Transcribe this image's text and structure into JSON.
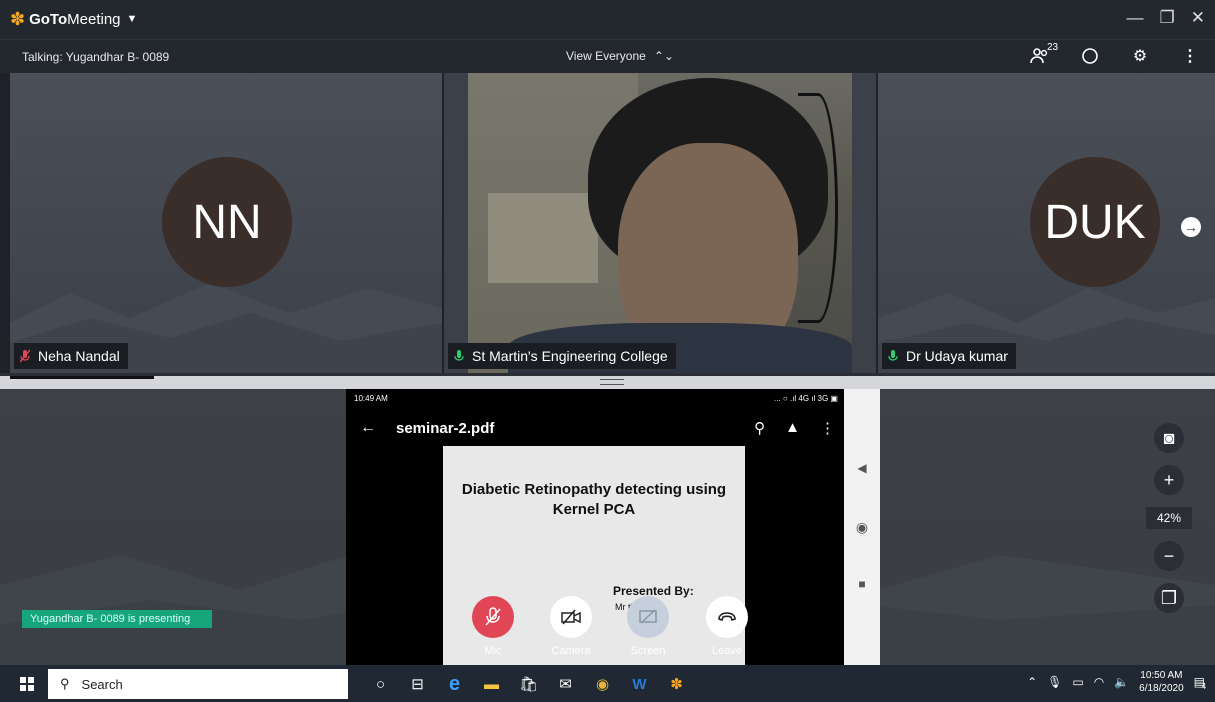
{
  "window": {
    "app_name_bold": "GoTo",
    "app_name_rest": "Meeting",
    "controls": [
      "minimize-icon",
      "restore-icon",
      "close-icon"
    ]
  },
  "toolbar": {
    "talking": "Talking: Yugandhar B- 0089",
    "view_label": "View Everyone",
    "attendee_count": "23"
  },
  "tiles": [
    {
      "initials": "NN",
      "name": "Neha Nandal",
      "mic_muted": true
    },
    {
      "initials": "",
      "name": "St Martin's Engineering  College",
      "mic_muted": false
    },
    {
      "initials": "DUK",
      "name": "Dr Udaya kumar",
      "mic_muted": false
    }
  ],
  "share": {
    "phone_time": "10:49 AM",
    "phone_status": "...  ○ .ıl 4G ıl 3G  ▣",
    "pdf_name": "seminar-2.pdf",
    "slide_title": "Diabetic Retinopathy detecting using Kernel PCA",
    "presented_by": "Presented By:",
    "presenter_partial": "Mr          thar",
    "presenting_banner": "Yugandhar B- 0089 is presenting",
    "zoom_pct": "42%"
  },
  "controls": {
    "mic": "Mic",
    "camera": "Camera",
    "screen": "Screen",
    "leave": "Leave"
  },
  "taskbar": {
    "search": "Search",
    "time": "10:50 AM",
    "date": "6/18/2020",
    "notifications": "4"
  },
  "colors": {
    "accent": "#f5a623",
    "muted_mic": "#e04656",
    "live_mic": "#2ecc71",
    "banner": "#17a67a"
  }
}
